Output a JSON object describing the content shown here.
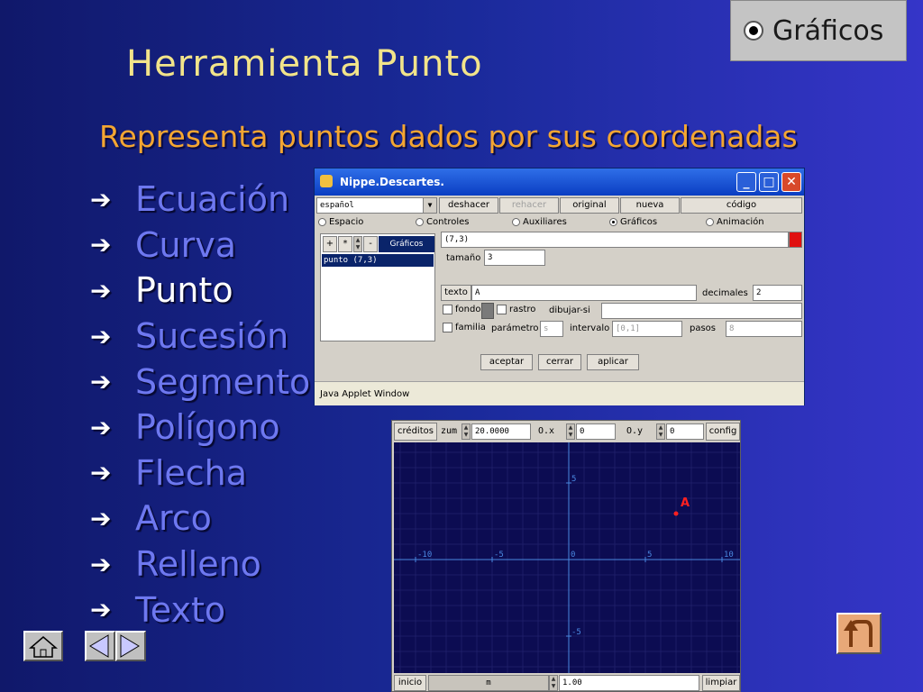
{
  "slide": {
    "title": "Herramienta Punto",
    "subtitle": "Representa puntos dados por sus coordenadas",
    "badge_label": "Gráficos",
    "menu": [
      {
        "label": "Ecuación",
        "active": false
      },
      {
        "label": "Curva",
        "active": false
      },
      {
        "label": "Punto",
        "active": true
      },
      {
        "label": "Sucesión",
        "active": false
      },
      {
        "label": "Segmento",
        "active": false
      },
      {
        "label": "Polígono",
        "active": false
      },
      {
        "label": "Flecha",
        "active": false
      },
      {
        "label": "Arco",
        "active": false
      },
      {
        "label": "Relleno",
        "active": false
      },
      {
        "label": "Texto",
        "active": false
      }
    ],
    "arrow_glyph": "➔",
    "colors": {
      "title": "#f2e48a",
      "subtitle": "#f4a632",
      "menu_text": "#6e78f0",
      "menu_active": "#ffffff"
    }
  },
  "applet": {
    "window_title": "Nippe.Descartes.",
    "language_value": "español",
    "toolbar": {
      "undo": "deshacer",
      "redo": "rehacer",
      "original": "original",
      "new": "nueva",
      "code": "código"
    },
    "tabs": [
      {
        "label": "Espacio",
        "selected": false
      },
      {
        "label": "Controles",
        "selected": false
      },
      {
        "label": "Auxiliares",
        "selected": false
      },
      {
        "label": "Gráficos",
        "selected": true
      },
      {
        "label": "Animación",
        "selected": false
      }
    ],
    "list_controls": {
      "add": "+",
      "star": "*",
      "minus": "-",
      "header": "Gráficos"
    },
    "list_items": [
      "punto (7,3)"
    ],
    "expression_value": "(7,3)",
    "expression_color": "#e01010",
    "size_label": "tamaño",
    "size_value": "3",
    "text_button": "texto",
    "text_value": "A",
    "decimals_label": "decimales",
    "decimals_value": "2",
    "background_label": "fondo",
    "trace_label": "rastro",
    "draw_if_label": "dibujar-si",
    "family_label": "familia",
    "param_label": "parámetro",
    "param_value": "s",
    "interval_label": "intervalo",
    "interval_value": "[0,1]",
    "steps_label": "pasos",
    "steps_value": "8",
    "buttons": {
      "accept": "aceptar",
      "close": "cerrar",
      "apply": "aplicar"
    },
    "status": "Java Applet Window"
  },
  "graph": {
    "credits": "créditos",
    "zoom_label": "zum",
    "zoom_value": "20.0000",
    "ox_label": "O.x",
    "ox_value": "0",
    "oy_label": "O.y",
    "oy_value": "0",
    "config": "config",
    "start": "inicio",
    "m_label": "m",
    "m_value": "1.00",
    "clear": "limpiar",
    "point_label": "A",
    "point": {
      "x": 7,
      "y": 3
    },
    "x_ticks": [
      "-10",
      "-5",
      "0",
      "5",
      "10"
    ],
    "y_ticks": [
      "5",
      "-5"
    ],
    "colors": {
      "background": "#0c0c52",
      "axis": "#4a88e0",
      "grid": "#2a2a78",
      "point": "#ff2020"
    }
  }
}
